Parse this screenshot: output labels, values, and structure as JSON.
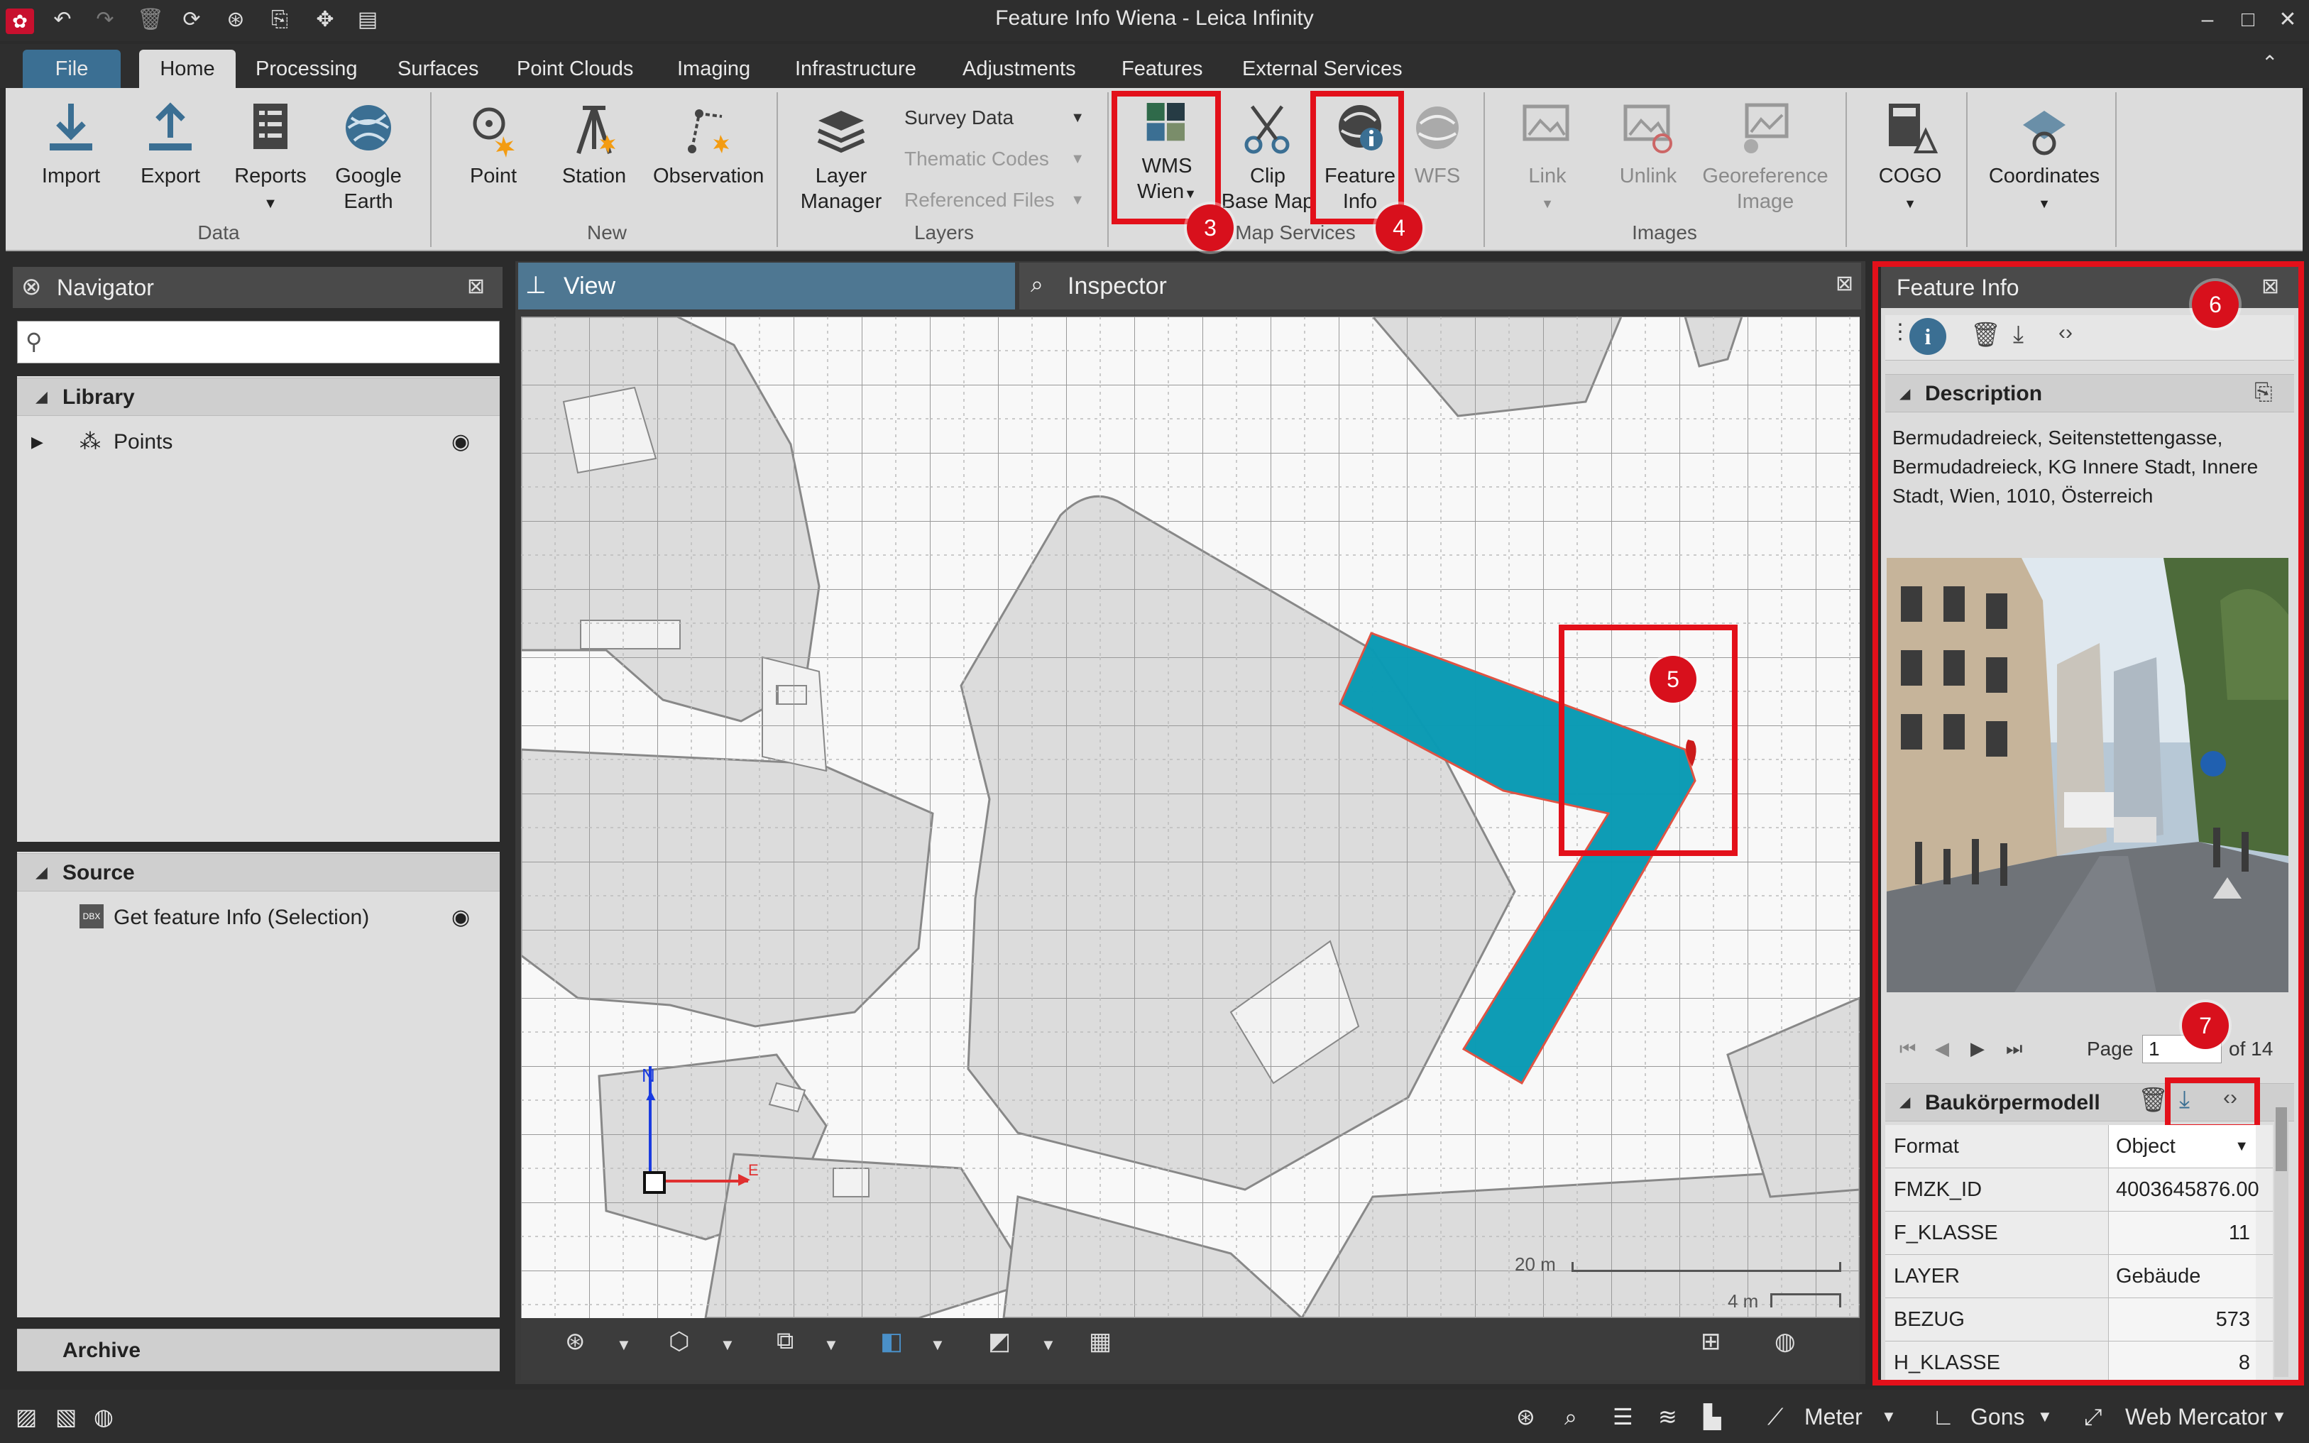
{
  "window": {
    "title": "Feature Info Wiena - Leica Infinity"
  },
  "menu": {
    "tabs": [
      "File",
      "Home",
      "Processing",
      "Surfaces",
      "Point Clouds",
      "Imaging",
      "Infrastructure",
      "Adjustments",
      "Features",
      "External Services"
    ]
  },
  "ribbon": {
    "data": {
      "label": "Data",
      "import": "Import",
      "export": "Export",
      "reports": "Reports",
      "google1": "Google",
      "google2": "Earth"
    },
    "new": {
      "label": "New",
      "point": "Point",
      "station": "Station",
      "observation": "Observation"
    },
    "layers": {
      "label": "Layers",
      "manager1": "Layer",
      "manager2": "Manager",
      "survey": "Survey Data",
      "thematic": "Thematic Codes",
      "referenced": "Referenced Files"
    },
    "map": {
      "label": "Map Services",
      "wms1": "WMS",
      "wms2": "Wien",
      "clip1": "Clip",
      "clip2": "Base Map",
      "fi1": "Feature",
      "fi2": "Info",
      "wfs": "WFS"
    },
    "images": {
      "label": "Images",
      "link": "Link",
      "unlink": "Unlink",
      "geo1": "Georeference",
      "geo2": "Image"
    },
    "cogo": "COGO",
    "coordinates": "Coordinates"
  },
  "callouts": [
    "3",
    "4",
    "5",
    "6",
    "7"
  ],
  "navigator": {
    "title": "Navigator",
    "library": {
      "title": "Library",
      "items": [
        "Points"
      ]
    },
    "source": {
      "title": "Source",
      "items": [
        "Get feature Info (Selection)"
      ]
    },
    "archive": "Archive"
  },
  "view": {
    "tab_view": "View",
    "tab_inspector": "Inspector",
    "scale1": "20 m",
    "scale2": "4 m",
    "north": "N",
    "east": "E"
  },
  "feature_info": {
    "title": "Feature Info",
    "description_title": "Description",
    "description": "Bermudadreieck, Seitenstettengasse, Bermudadreieck, KG Innere Stadt, Innere Stadt, Wien, 1010, Österreich",
    "page_label": "Page",
    "page_value": "1",
    "page_of": "of 14",
    "section": "Baukörpermodell",
    "rows": [
      {
        "key": "Format",
        "value": "Object"
      },
      {
        "key": "FMZK_ID",
        "value": "4003645876.00"
      },
      {
        "key": "F_KLASSE",
        "value": "11"
      },
      {
        "key": "LAYER",
        "value": "Gebäude"
      },
      {
        "key": "BEZUG",
        "value": "573"
      },
      {
        "key": "H_KLASSE",
        "value": "8"
      }
    ]
  },
  "status": {
    "units": "Meter",
    "angle": "Gons",
    "projection": "Web Mercator"
  },
  "colors": {
    "accent": "#3b6f93",
    "highlight": "#0a9bb4",
    "callout": "#d8101c"
  }
}
